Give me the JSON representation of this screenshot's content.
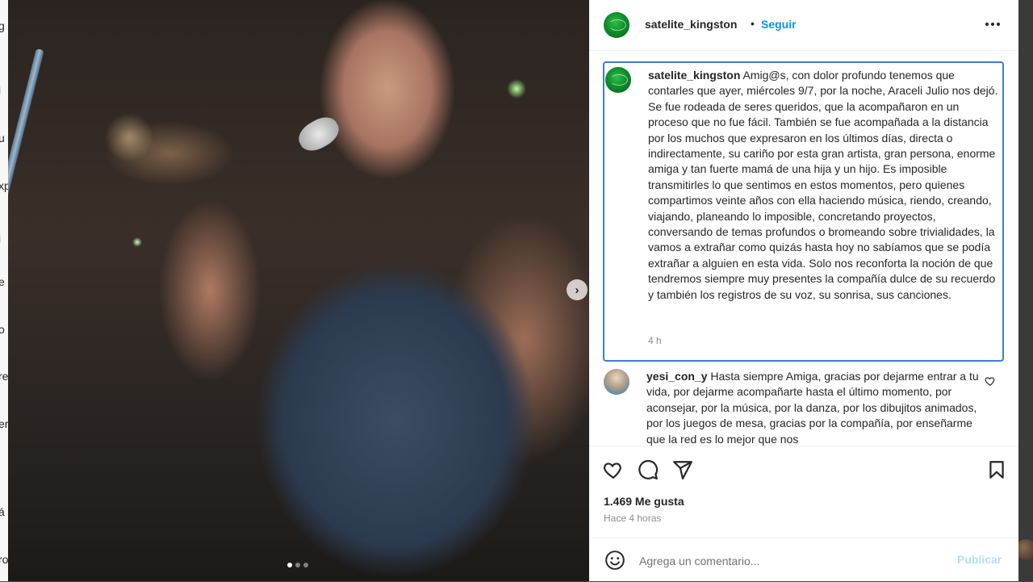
{
  "background": {
    "left_letters": [
      "g",
      "i",
      "u",
      "xp",
      "i",
      "e",
      "o",
      "re",
      "er",
      "á",
      "ro"
    ]
  },
  "header": {
    "username": "satelite_kingston",
    "separator": "•",
    "follow_label": "Seguir",
    "more_icon": "ellipsis-horizontal-icon"
  },
  "caption": {
    "username": "satelite_kingston",
    "text": "Amig@s, con dolor profundo tenemos que contarles que ayer, miércoles 9/7, por la noche, Araceli Julio nos dejó. Se fue rodeada de seres queridos, que la acompañaron en un proceso que no fue fácil. También se fue acompañada a la distancia por los muchos que expresaron en los últimos días, directa o indirectamente, su cariño por esta gran artista, gran persona, enorme amiga y tan fuerte mamá de una hija y un hijo. Es imposible transmitirles lo que sentimos en estos momentos, pero quienes compartimos veinte años con ella haciendo música, riendo, creando, viajando, planeando lo imposible, concretando proyectos, conversando de temas profundos o bromeando sobre trivialidades, la vamos a extrañar como quizás hasta hoy no sabíamos que se podía extrañar a alguien en esta vida. Solo nos reconforta la noción de que tendremos siempre muy presentes la compañía dulce de su recuerdo y también los registros de su voz, su sonrisa, sus canciones.",
    "time": "4 h"
  },
  "comment": {
    "username": "yesi_con_y",
    "text": "Hasta siempre Amiga, gracias por dejarme entrar a tu vida, por dejarme acompañarte hasta el último momento, por aconsejar, por la música, por la danza, por los dibujitos animados, por los juegos de mesa, gracias por la compañía, por enseñarme que la red es lo mejor que nos"
  },
  "actions": {
    "icons": [
      "heart-icon",
      "comment-icon",
      "share-icon",
      "bookmark-icon"
    ],
    "likes": "1.469 Me gusta",
    "time_ago": "Hace 4 horas"
  },
  "add_comment": {
    "placeholder": "Agrega un comentario...",
    "publish_label": "Publicar"
  },
  "carousel": {
    "next_glyph": "›",
    "total_slides": 3,
    "active_slide": 1
  },
  "colors": {
    "link_blue": "#0095f6",
    "focus_border": "#3e7ed8",
    "publish_disabled": "#b2dffc"
  }
}
